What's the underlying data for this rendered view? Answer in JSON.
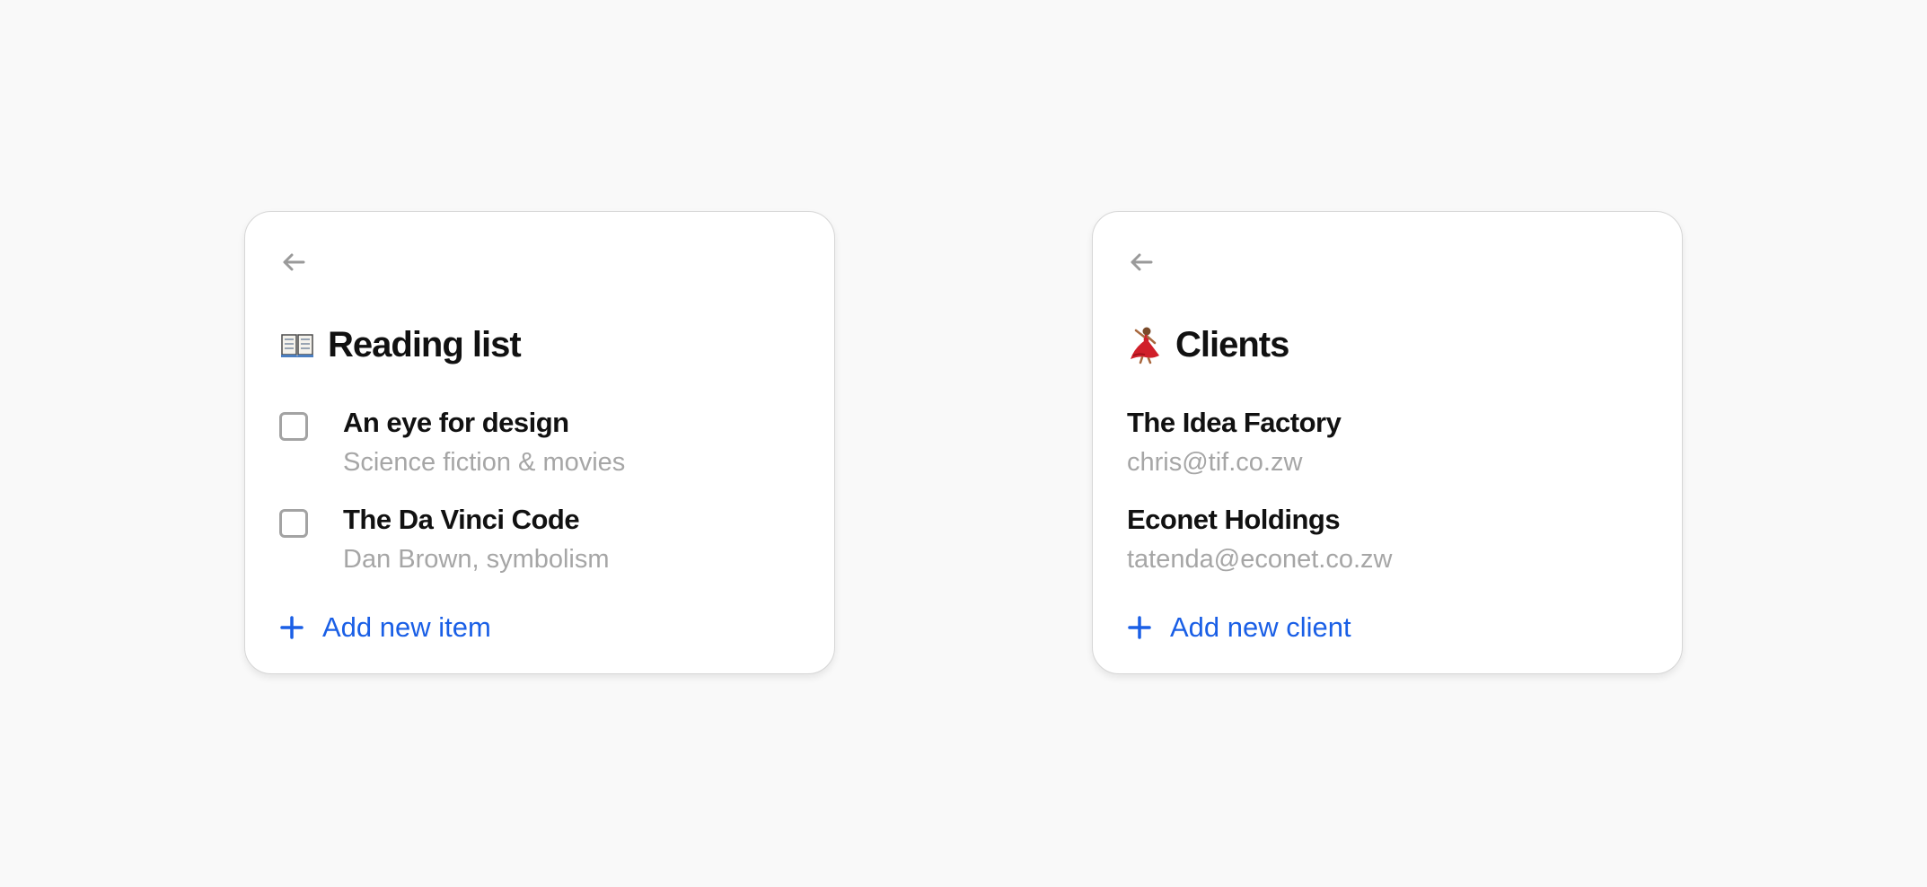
{
  "colors": {
    "background": "#f9f9f9",
    "card": "#ffffff",
    "accent": "#1a5fe6",
    "muted_text": "#a6a6a6",
    "primary_text": "#111111"
  },
  "reading_list": {
    "back_icon": "arrow-left-icon",
    "title_icon": "open-book-icon",
    "title": "Reading list",
    "items": [
      {
        "title": "An eye for design",
        "subtitle": "Science fiction & movies",
        "checked": false
      },
      {
        "title": "The Da Vinci Code",
        "subtitle": "Dan Brown, symbolism",
        "checked": false
      }
    ],
    "add_icon": "plus-icon",
    "add_label": "Add new item"
  },
  "clients": {
    "back_icon": "arrow-left-icon",
    "title_icon": "dancer-icon",
    "title": "Clients",
    "items": [
      {
        "title": "The Idea Factory",
        "subtitle": "chris@tif.co.zw"
      },
      {
        "title": "Econet Holdings",
        "subtitle": "tatenda@econet.co.zw"
      }
    ],
    "add_icon": "plus-icon",
    "add_label": "Add new client"
  }
}
